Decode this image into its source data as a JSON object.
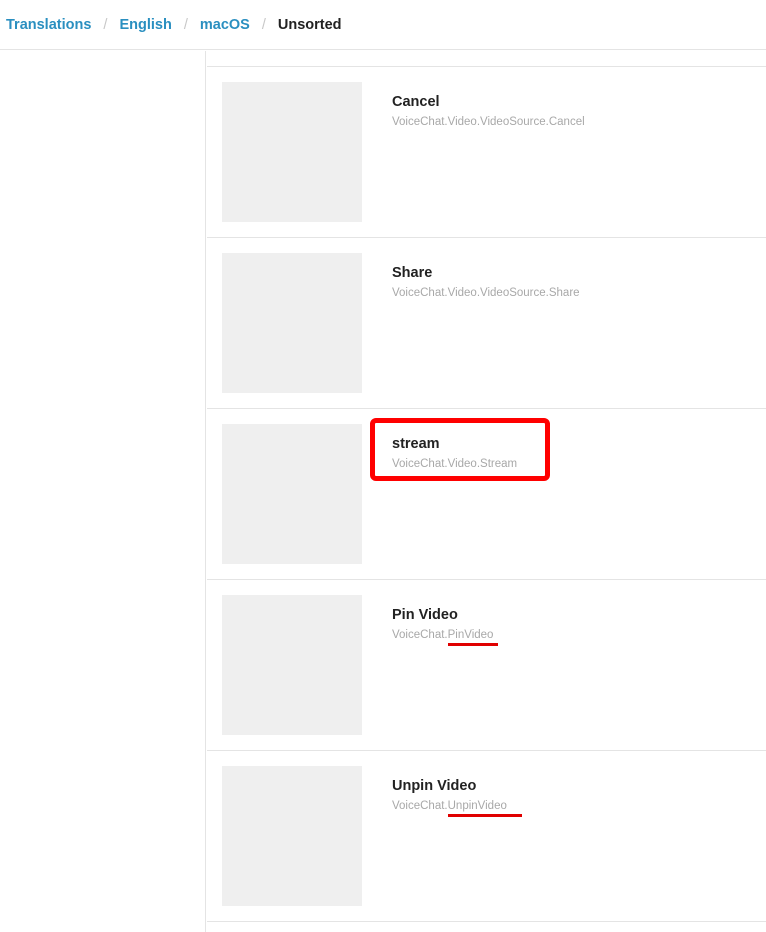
{
  "breadcrumb": {
    "items": [
      "Translations",
      "English",
      "macOS"
    ],
    "separator": "/",
    "current": "Unsorted"
  },
  "entries": [
    {
      "title": "Cancel",
      "key": "VoiceChat.Video.VideoSource.Cancel"
    },
    {
      "title": "Share",
      "key": "VoiceChat.Video.VideoSource.Share"
    },
    {
      "title": "stream",
      "key": "VoiceChat.Video.Stream"
    },
    {
      "title": "Pin Video",
      "key": "VoiceChat.PinVideo"
    },
    {
      "title": "Unpin Video",
      "key": "VoiceChat.UnpinVideo"
    }
  ],
  "colors": {
    "link": "#2a8fc0",
    "annotation": "#ff0000",
    "thumbnail": "#efefef"
  }
}
